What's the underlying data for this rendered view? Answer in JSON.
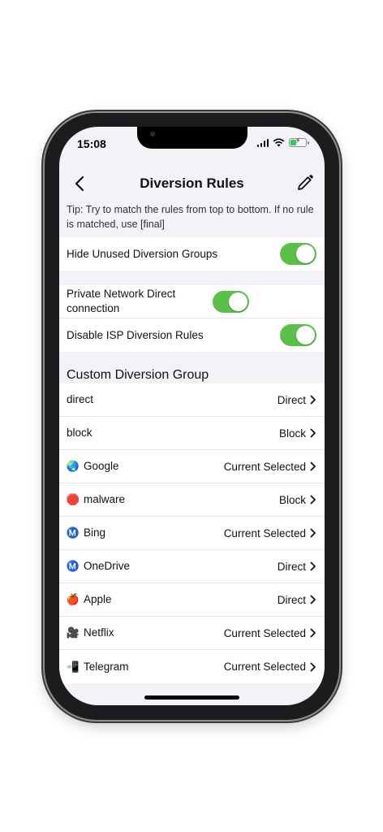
{
  "status_bar": {
    "time": "15:08"
  },
  "nav": {
    "title": "Diversion Rules",
    "back_icon": "chevron-left-icon",
    "edit_icon": "pencil-icon"
  },
  "tip": "Tip: Try to match the rules from top to bottom. If no rule is matched, use [final]",
  "settings": {
    "hide_unused": {
      "label": "Hide Unused Diversion Groups",
      "enabled": true
    },
    "private_network": {
      "label": "Private Network Direct connection",
      "enabled": true
    },
    "disable_isp": {
      "label": "Disable ISP Diversion Rules",
      "enabled": true
    }
  },
  "colors": {
    "toggle_on": "#5ac04a",
    "background": "#f2f2f7"
  },
  "custom_group": {
    "header": "Custom Diversion Group",
    "items": [
      {
        "icon": "",
        "name": "direct",
        "value": "Direct"
      },
      {
        "icon": "",
        "name": "block",
        "value": "Block"
      },
      {
        "icon": "🌏",
        "name": "Google",
        "value": "Current Selected"
      },
      {
        "icon": "🛑",
        "name": "malware",
        "value": "Block"
      },
      {
        "icon": "Ⓜ️",
        "name": "Bing",
        "value": "Current Selected"
      },
      {
        "icon": "Ⓜ️",
        "name": "OneDrive",
        "value": "Direct"
      },
      {
        "icon": "🍎",
        "name": "Apple",
        "value": "Direct"
      },
      {
        "icon": "🎥",
        "name": "Netflix",
        "value": "Current Selected"
      },
      {
        "icon": "📲",
        "name": "Telegram",
        "value": "Current Selected"
      }
    ]
  }
}
